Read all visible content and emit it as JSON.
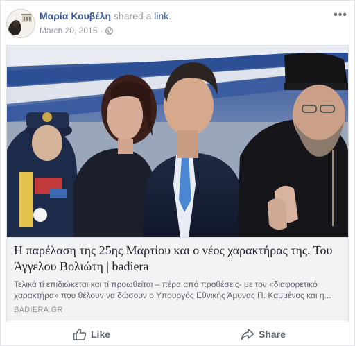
{
  "post": {
    "author": "Μαρία Κουβέλη",
    "action_text": "shared a",
    "action_link": "link",
    "action_period": ".",
    "date": "March 20, 2015",
    "separator": "·",
    "more_label": "•••"
  },
  "link_card": {
    "title": "Η παρέλαση της 25ης Μαρτίου και ο νέος χαρακτήρας της. Του Άγγελου Βολιώτη | badiera",
    "description": "Τελικά τί επιδιώκεται και τί προωθείται – πέρα από προθέσεις- με τον «διαφορετικό χαρακτήρα» που θέλουν να δώσουν ο Υπουργός Εθνικής Άμυνας Π. Καμμένος και η...",
    "domain": "BADIERA.GR"
  },
  "actions": {
    "like_label": "Like",
    "share_label": "Share"
  },
  "icons": {
    "globe": "globe-icon",
    "like": "thumbs-up-icon",
    "share": "share-arrow-icon",
    "more": "more-options-icon"
  },
  "colors": {
    "link_blue": "#365899",
    "meta_gray": "#90949c",
    "card_bg": "#f2f3f5"
  }
}
